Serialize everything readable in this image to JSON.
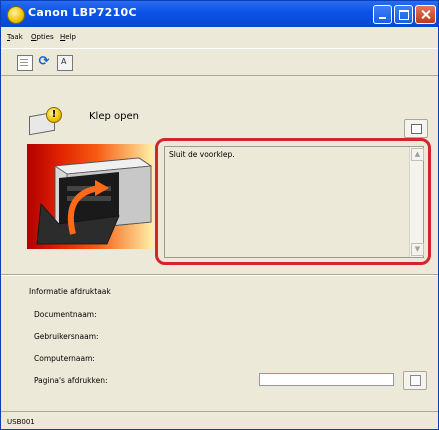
{
  "window": {
    "title": "Canon LBP7210C"
  },
  "menu": {
    "items": [
      {
        "label_prefix": "",
        "accel": "T",
        "label_rest": "aak"
      },
      {
        "label_prefix": "",
        "accel": "O",
        "label_rest": "pties"
      },
      {
        "label_prefix": "",
        "accel": "H",
        "label_rest": "elp"
      }
    ]
  },
  "toolbar": {
    "icons": [
      "document-icon",
      "refresh-icon",
      "print-settings-icon"
    ]
  },
  "status": {
    "text": "Klep open",
    "message": "Sluit de voorklep."
  },
  "info": {
    "title": "Informatie afdruktaak",
    "document_name_label": "Documentnaam:",
    "user_name_label": "Gebruikersnaam:",
    "computer_name_label": "Computernaam:",
    "pages_printed_label": "Pagina's afdrukken:",
    "pages_printed_value": ""
  },
  "statusbar": {
    "port": "USB001"
  },
  "colors": {
    "titlebar": "#0a52e6",
    "window_bg": "#ece9d8",
    "highlight": "#d6242a"
  }
}
